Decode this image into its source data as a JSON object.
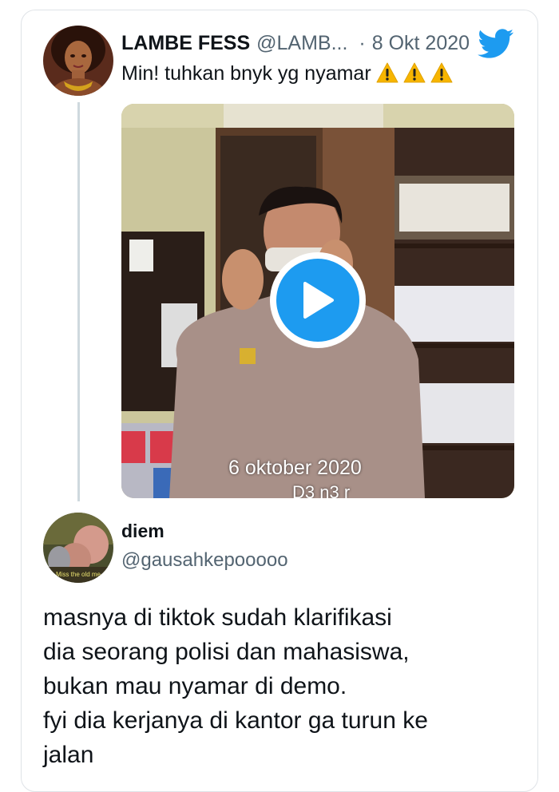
{
  "quoted_tweet": {
    "display_name": "LAMBE FESS",
    "handle": "@LAMB...",
    "separator": "·",
    "date": "8 Okt 2020",
    "text": "Min! tuhkan bnyk yg nyamar",
    "emoji_icons": [
      "warning-icon",
      "warning-icon",
      "warning-icon"
    ],
    "media": {
      "type": "video",
      "overlay_date": "6 oktober 2020",
      "overlay_sub": "D3 n3 r"
    }
  },
  "reply": {
    "display_name": "diem",
    "handle": "@gausahkepooooo",
    "avatar_caption": "Miss the old me",
    "body_lines": [
      "masnya di tiktok sudah klarifikasi",
      "dia seorang polisi dan mahasiswa,",
      "bukan mau nyamar di demo.",
      "fyi dia kerjanya di kantor ga turun ke",
      "jalan"
    ]
  },
  "colors": {
    "twitter_blue": "#1d9bf0",
    "text_primary": "#0f1419",
    "text_secondary": "#536471",
    "border": "#dfe3e7",
    "warning_yellow": "#f7b500"
  }
}
